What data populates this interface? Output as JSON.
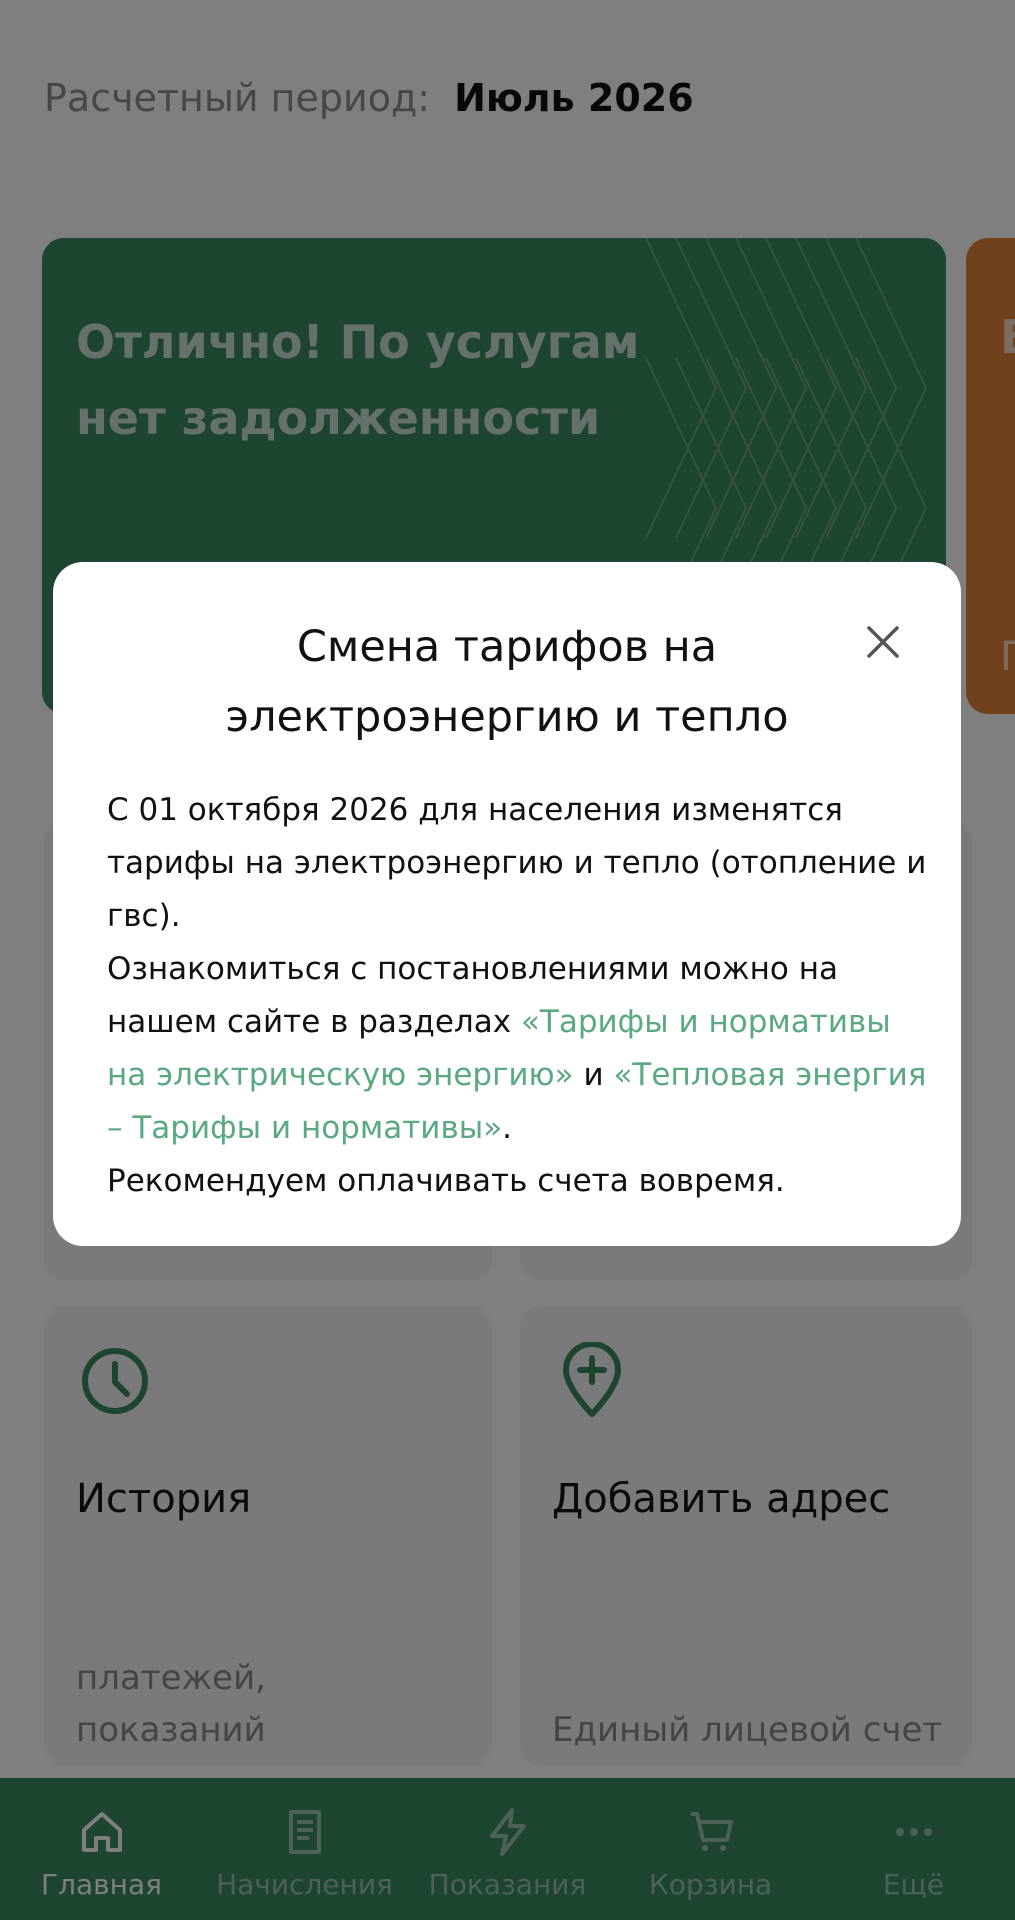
{
  "period": {
    "label": "Расчетный период:",
    "value": "Июль 2026"
  },
  "status_card": {
    "title": "Отлично! По услугам нет задолженности"
  },
  "orange_card": {
    "title_initial": "В",
    "subtitle_initial": "П"
  },
  "tiles": {
    "history": {
      "title": "История",
      "subtitle_line1": "платежей,",
      "subtitle_line2": "показаний"
    },
    "add_address": {
      "title": "Добавить адрес",
      "subtitle": "Единый лицевой счет"
    }
  },
  "modal": {
    "title": "Смена тарифов на электроэнергию и тепло",
    "p1": "С 01 октября 2026 для населения изменятся тарифы на электроэнергию и тепло (отопление и гвс).",
    "p2_prefix": "Ознакомиться с постановлениями можно на нашем сайте в разделах ",
    "link1": "«Тарифы и нормативы на электрическую энергию»",
    "and": " и ",
    "link2": "«Тепловая энергия – Тарифы и нормативы»",
    "dot": ".",
    "p3": "Рекомендуем оплачивать счета вовремя."
  },
  "nav": {
    "home": "Главная",
    "charges": "Начисления",
    "readings": "Показания",
    "cart": "Корзина",
    "more": "Ещё"
  },
  "colors": {
    "brand_green": "#3a8a5e",
    "accent_orange": "#e2813a",
    "link_green": "#5aa982"
  },
  "icons": {
    "history": "clock-icon",
    "add_address": "location-plus-icon",
    "close": "close-icon",
    "home": "home-icon",
    "charges": "receipt-icon",
    "readings": "lightning-icon",
    "cart": "cart-icon",
    "more": "more-dots-icon"
  }
}
